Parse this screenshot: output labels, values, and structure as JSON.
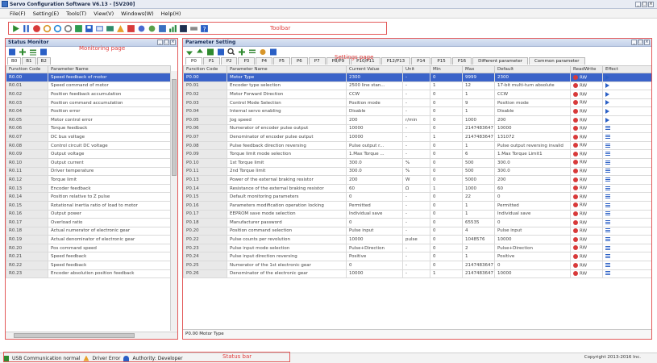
{
  "window": {
    "title": "Servo Configuration Software V6.13 - [SV200]"
  },
  "menu": [
    "File(F)",
    "Setting(E)",
    "Tools(T)",
    "View(V)",
    "Windows(W)",
    "Help(H)"
  ],
  "toolbar": {
    "annotation": "Toolbar",
    "icons": [
      "play-icon",
      "pause-icon",
      "stop-icon",
      "refresh-icon",
      "cycle-icon",
      "connect-icon",
      "monitor-icon",
      "save-icon",
      "chart-icon",
      "alarm-icon",
      "settings-icon",
      "gear-icon",
      "upload-icon",
      "download-icon",
      "dataset-icon",
      "help-icon"
    ]
  },
  "monitor": {
    "title": "Status Monitor",
    "annotation": "Monitoring page",
    "tabs": [
      "B0",
      "B1",
      "B2"
    ],
    "columns": [
      "Function Code",
      "Parameter Name"
    ],
    "rows": [
      [
        "R0.00",
        "Speed feedback of motor"
      ],
      [
        "R0.01",
        "Speed command of motor"
      ],
      [
        "R0.02",
        "Position feedback accumulation"
      ],
      [
        "R0.03",
        "Position command accumulation"
      ],
      [
        "R0.04",
        "Position error"
      ],
      [
        "R0.05",
        "Motor control error"
      ],
      [
        "R0.06",
        "Torque feedback"
      ],
      [
        "R0.07",
        "DC bus voltage"
      ],
      [
        "R0.08",
        "Control circuit DC voltage"
      ],
      [
        "R0.09",
        "Output voltage"
      ],
      [
        "R0.10",
        "Output current"
      ],
      [
        "R0.11",
        "Driver temperature"
      ],
      [
        "R0.12",
        "Torque limit"
      ],
      [
        "R0.13",
        "Encoder feedback"
      ],
      [
        "R0.14",
        "Position relative to Z pulse"
      ],
      [
        "R0.15",
        "Rotational inertia ratio of load to motor"
      ],
      [
        "R0.16",
        "Output power"
      ],
      [
        "R0.17",
        "Overload ratio"
      ],
      [
        "R0.18",
        "Actual numerator of electronic gear"
      ],
      [
        "R0.19",
        "Actual denominator of electronic gear"
      ],
      [
        "R0.20",
        "Pos command speed"
      ],
      [
        "R0.21",
        "Speed feedback"
      ],
      [
        "R0.22",
        "Speed feedback"
      ],
      [
        "R0.23",
        "Encoder absolution position feedback"
      ]
    ]
  },
  "settings": {
    "title": "Parameter Setting",
    "annotation": "Settings page",
    "tabs": [
      "P0",
      "P1",
      "P2",
      "P3",
      "P4",
      "P5",
      "P6",
      "P7",
      "P8/P9",
      "P10/P11",
      "P12/P13",
      "P14",
      "P15",
      "P16",
      "Different parameter",
      "Common parameter"
    ],
    "columns": [
      "Function Code",
      "Parameter Name",
      "Current Value",
      "Unit",
      "Min",
      "Max",
      "Default",
      "ReadWrite",
      "Effect"
    ],
    "rows": [
      [
        "P0.00",
        "Motor Type",
        "2300",
        "-",
        "0",
        "9999",
        "2300",
        "RW"
      ],
      [
        "P0.01",
        "Encoder type selection",
        "2500 line stan...",
        "-",
        "1",
        "12",
        "17-bit multi-turn absolute",
        "RW"
      ],
      [
        "P0.02",
        "Motor Forward Direction",
        "CCW",
        "-",
        "0",
        "1",
        "CCW",
        "RW"
      ],
      [
        "P0.03",
        "Control Mode Selection",
        "Position mode",
        "-",
        "0",
        "9",
        "Position mode",
        "RW"
      ],
      [
        "P0.04",
        "Internal servo enabling",
        "Disable",
        "-",
        "0",
        "1",
        "Disable",
        "RW"
      ],
      [
        "P0.05",
        "Jog speed",
        "200",
        "r/min",
        "0",
        "1000",
        "200",
        "RW"
      ],
      [
        "P0.06",
        "Numerator of encoder pulse output",
        "10000",
        "-",
        "0",
        "2147483647",
        "10000",
        "RW"
      ],
      [
        "P0.07",
        "Denominator of encoder pulse output",
        "10000",
        "-",
        "1",
        "2147483647",
        "131072",
        "RW"
      ],
      [
        "P0.08",
        "Pulse feedback direction reversing",
        "Pulse output r...",
        "-",
        "0",
        "1",
        "Pulse output reversing invalid",
        "RW"
      ],
      [
        "P0.09",
        "Torque limit mode selection",
        "1.Max Torque ...",
        "-",
        "0",
        "6",
        "1.Max Torque Limit1",
        "RW"
      ],
      [
        "P0.10",
        "1st Torque limit",
        "300.0",
        "%",
        "0",
        "500",
        "300.0",
        "RW"
      ],
      [
        "P0.11",
        "2nd Torque limit",
        "300.0",
        "%",
        "0",
        "500",
        "300.0",
        "RW"
      ],
      [
        "P0.13",
        "Power of the external braking resistor",
        "200",
        "W",
        "0",
        "5000",
        "200",
        "RW"
      ],
      [
        "P0.14",
        "Resistance of the external braking resistor",
        "60",
        "Ω",
        "1",
        "1000",
        "60",
        "RW"
      ],
      [
        "P0.15",
        "Default monitoring parameters",
        "0",
        "-",
        "0",
        "22",
        "0",
        "RW"
      ],
      [
        "P0.16",
        "Parameters modification operation locking",
        "Permitted",
        "-",
        "0",
        "1",
        "Permitted",
        "RW"
      ],
      [
        "P0.17",
        "EEPROM save mode selection",
        "Individual save",
        "-",
        "0",
        "1",
        "Individual save",
        "RW"
      ],
      [
        "P0.18",
        "Manufacturer password",
        "0",
        "-",
        "0",
        "65535",
        "0",
        "RW"
      ],
      [
        "P0.20",
        "Position command selection",
        "Pulse input",
        "-",
        "0",
        "4",
        "Pulse input",
        "RW"
      ],
      [
        "P0.22",
        "Pulse counts per revolution",
        "10000",
        "pulse",
        "0",
        "1048576",
        "10000",
        "RW"
      ],
      [
        "P0.23",
        "Pulse input mode selection",
        "Pulse+Direction",
        "-",
        "0",
        "2",
        "Pulse+Direction",
        "RW"
      ],
      [
        "P0.24",
        "Pulse input direction reversing",
        "Positive",
        "-",
        "0",
        "1",
        "Positive",
        "RW"
      ],
      [
        "P0.25",
        "Numerator of the 1st electronic gear",
        "0",
        "-",
        "0",
        "2147483647",
        "0",
        "RW"
      ],
      [
        "P0.26",
        "Denominator of the electronic gear",
        "10000",
        "-",
        "1",
        "2147483647",
        "10000",
        "RW"
      ]
    ],
    "effect": [
      "P",
      "P",
      "P",
      "P",
      "P",
      "P",
      "bars",
      "bars",
      "bars",
      "bars",
      "bars",
      "bars",
      "bars",
      "bars",
      "bars",
      "bars",
      "bars",
      "bars",
      "bars",
      "bars",
      "bars",
      "bars",
      "bars",
      "bars"
    ],
    "selected_description": "P0.00 Motor Type"
  },
  "status": {
    "annotation": "Status bar",
    "items": [
      "USB Communication normal",
      "Driver Error",
      "Authority: Developer"
    ],
    "copyright": "Copyright 2013-2016 Inc."
  },
  "colors": {
    "accent": "#3a63c9",
    "annotation": "#e03c3c",
    "alarm": "#d83a3a"
  }
}
